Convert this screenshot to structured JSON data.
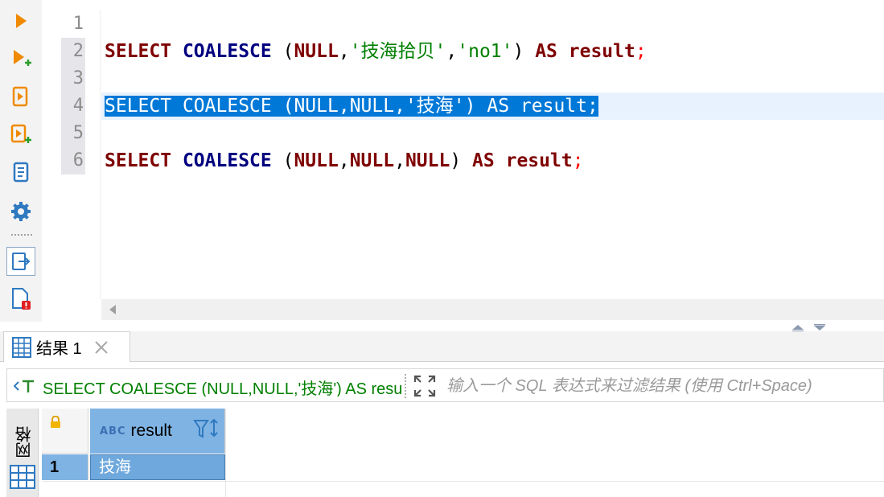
{
  "toolbar": {
    "icons": [
      "execute-icon",
      "execute-new-tab-icon",
      "execute-script-icon",
      "execute-script-new-tab-icon",
      "explain-plan-icon",
      "settings-icon",
      "export-icon",
      "error-log-icon"
    ]
  },
  "editor": {
    "line_numbers": [
      "1",
      "2",
      "3",
      "4",
      "5",
      "6"
    ],
    "line2": {
      "kw1": "SELECT",
      "fn": "COALESCE",
      "p1": " (",
      "kw2": "NULL",
      "c1": ",",
      "s1": "'技海拾贝'",
      "c2": ",",
      "s2": "'no1'",
      "p2": ") ",
      "kw3": "AS",
      "kw4": "result",
      "semi": ";"
    },
    "line4": {
      "kw1": "SELECT",
      "fn": "COALESCE",
      "p1": " (",
      "kw2": "NULL",
      "c1": ",",
      "kw3": "NULL",
      "c2": ",",
      "s1": "'技海'",
      "p2": ") ",
      "kw4": "AS",
      "kw5": "result",
      "semi": ";"
    },
    "line6": {
      "kw1": "SELECT",
      "fn": "COALESCE",
      "p1": " (",
      "kw2": "NULL",
      "c1": ",",
      "kw3": "NULL",
      "c2": ",",
      "kw4": "NULL",
      "p2": ") ",
      "kw5": "AS",
      "kw6": "result",
      "semi": ";"
    }
  },
  "results": {
    "tab_label": "结果 1",
    "filter_query": "SELECT COALESCE (NULL,NULL,'技海') AS result",
    "filter_placeholder": "输入一个 SQL 表达式来过滤结果 (使用 Ctrl+Space)",
    "side_label": "网格",
    "column_type": "ABC",
    "column_name": "result",
    "rows": [
      {
        "num": "1",
        "value": "技海"
      }
    ]
  },
  "colors": {
    "keyword": "#7f0000",
    "function": "#000080",
    "string": "#008000",
    "selection": "#0078d7",
    "header_blue": "#7fb3e3"
  }
}
